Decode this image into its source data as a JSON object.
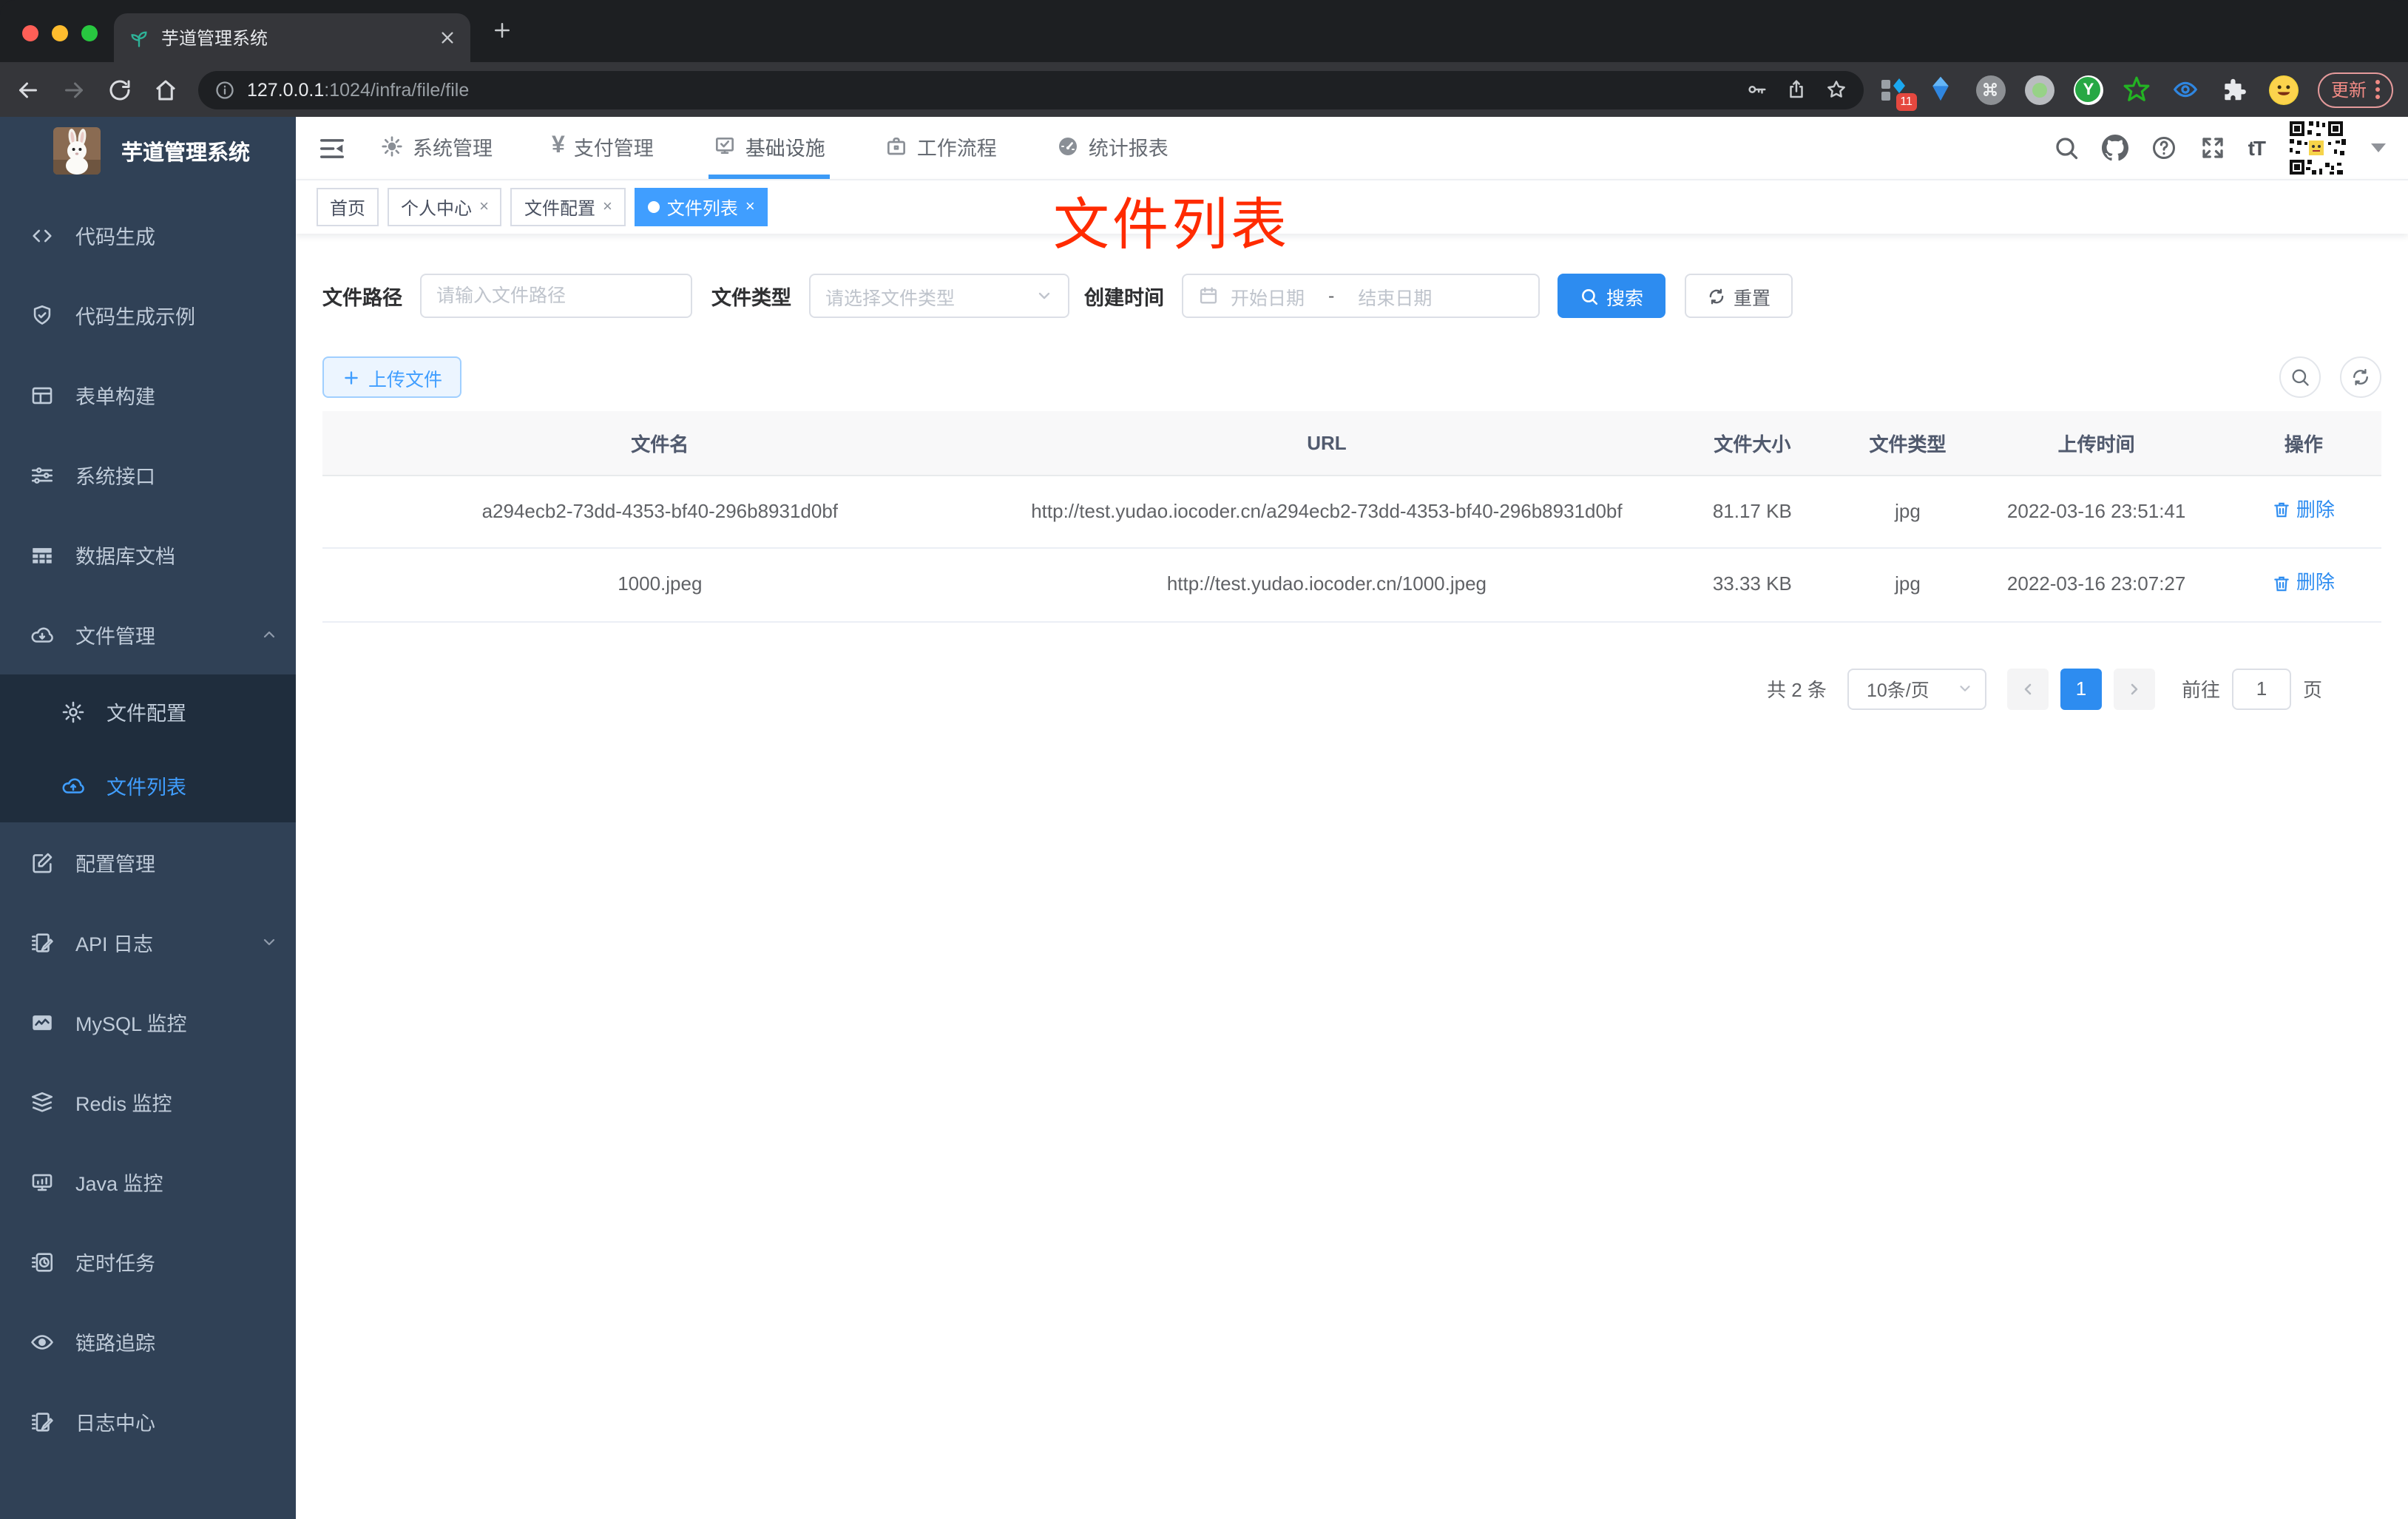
{
  "browser": {
    "tab_title": "芋道管理系统",
    "url_host": "127.0.0.1",
    "url_rest": ":1024/infra/file/file",
    "ext_badge": "11",
    "update_label": "更新"
  },
  "sidebar": {
    "title": "芋道管理系统",
    "items": [
      {
        "label": "代码生成",
        "icon": "code-icon"
      },
      {
        "label": "代码生成示例",
        "icon": "shield-check-icon"
      },
      {
        "label": "表单构建",
        "icon": "form-builder-icon"
      },
      {
        "label": "系统接口",
        "icon": "sliders-icon"
      },
      {
        "label": "数据库文档",
        "icon": "database-doc-icon"
      },
      {
        "label": "文件管理",
        "icon": "cloud-download-icon",
        "expanded": true
      },
      {
        "label": "文件配置",
        "icon": "gear-icon",
        "submenu": true
      },
      {
        "label": "文件列表",
        "icon": "cloud-upload-icon",
        "submenu": true,
        "active": true
      },
      {
        "label": "配置管理",
        "icon": "edit-square-icon"
      },
      {
        "label": "API 日志",
        "icon": "log-edit-icon",
        "collapsed": true
      },
      {
        "label": "MySQL 监控",
        "icon": "chart-monitor-icon"
      },
      {
        "label": "Redis 监控",
        "icon": "layers-icon"
      },
      {
        "label": "Java 监控",
        "icon": "display-icon"
      },
      {
        "label": "定时任务",
        "icon": "timer-icon"
      },
      {
        "label": "链路追踪",
        "icon": "eye-icon"
      },
      {
        "label": "日志中心",
        "icon": "log-edit-icon"
      }
    ]
  },
  "topnav": {
    "menus": [
      {
        "label": "系统管理",
        "icon": "gear-icon"
      },
      {
        "label": "支付管理",
        "icon": "yen-icon",
        "glyph": "¥"
      },
      {
        "label": "基础设施",
        "icon": "infra-check-icon",
        "active": true
      },
      {
        "label": "工作流程",
        "icon": "briefcase-icon"
      },
      {
        "label": "统计报表",
        "icon": "dashboard-icon"
      }
    ],
    "font_size_glyph": "tT"
  },
  "tags": [
    {
      "label": "首页",
      "closable": false
    },
    {
      "label": "个人中心",
      "closable": true
    },
    {
      "label": "文件配置",
      "closable": true
    },
    {
      "label": "文件列表",
      "closable": true,
      "active": true
    }
  ],
  "annotation": {
    "text": "文件列表"
  },
  "filters": {
    "path_label": "文件路径",
    "path_placeholder": "请输入文件路径",
    "type_label": "文件类型",
    "type_placeholder": "请选择文件类型",
    "time_label": "创建时间",
    "start_placeholder": "开始日期",
    "range_separator": "-",
    "end_placeholder": "结束日期",
    "search_label": "搜索",
    "reset_label": "重置"
  },
  "toolbar": {
    "upload_label": "上传文件"
  },
  "table": {
    "headers": [
      "文件名",
      "URL",
      "文件大小",
      "文件类型",
      "上传时间",
      "操作"
    ],
    "rows": [
      {
        "name": "a294ecb2-73dd-4353-bf40-296b8931d0bf",
        "url": "http://test.yudao.iocoder.cn/a294ecb2-73dd-4353-bf40-296b8931d0bf",
        "size": "81.17 KB",
        "type": "jpg",
        "time": "2022-03-16 23:51:41",
        "action": "删除"
      },
      {
        "name": "1000.jpeg",
        "url": "http://test.yudao.iocoder.cn/1000.jpeg",
        "size": "33.33 KB",
        "type": "jpg",
        "time": "2022-03-16 23:07:27",
        "action": "删除"
      }
    ]
  },
  "pagination": {
    "total": "共 2 条",
    "page_size": "10条/页",
    "current_page": "1",
    "goto_label": "前往",
    "goto_value": "1",
    "page_unit": "页"
  },
  "colors": {
    "accent": "#2d8cf0",
    "tag_active": "#409eff",
    "sidebar_bg": "#304156",
    "submenu_bg": "#1f2d3d",
    "annotation_red": "#ff2b00"
  }
}
